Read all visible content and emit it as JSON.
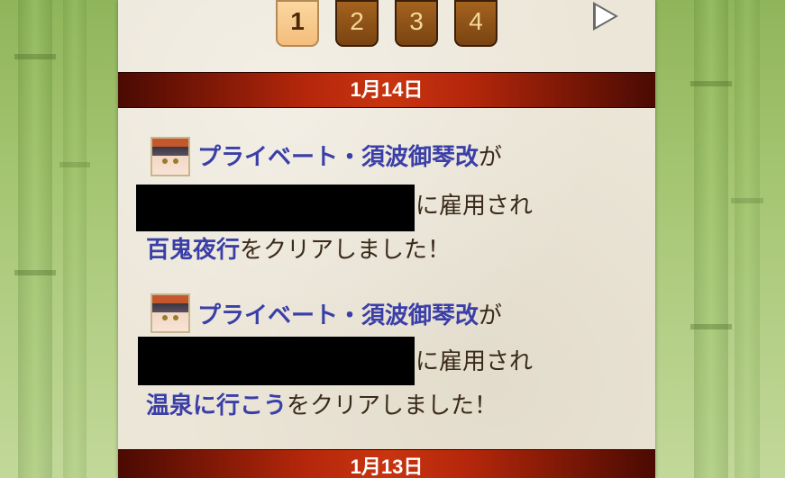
{
  "pagination": {
    "pages": [
      "1",
      "2",
      "3",
      "4"
    ],
    "current": "1",
    "next_icon": "play-triangle-icon"
  },
  "sections": [
    {
      "date": "1月14日",
      "entries": [
        {
          "player_name": "プライベート・須波御琴改",
          "particle": "が",
          "hired_text": "に雇用され",
          "mission": "百鬼夜行",
          "suffix": "をクリアしました！"
        },
        {
          "player_name": "プライベート・須波御琴改",
          "particle": "が",
          "hired_text": "に雇用され",
          "mission": "温泉に行こう",
          "suffix": "をクリアしました！"
        }
      ]
    },
    {
      "date": "1月13日",
      "entries": []
    }
  ]
}
